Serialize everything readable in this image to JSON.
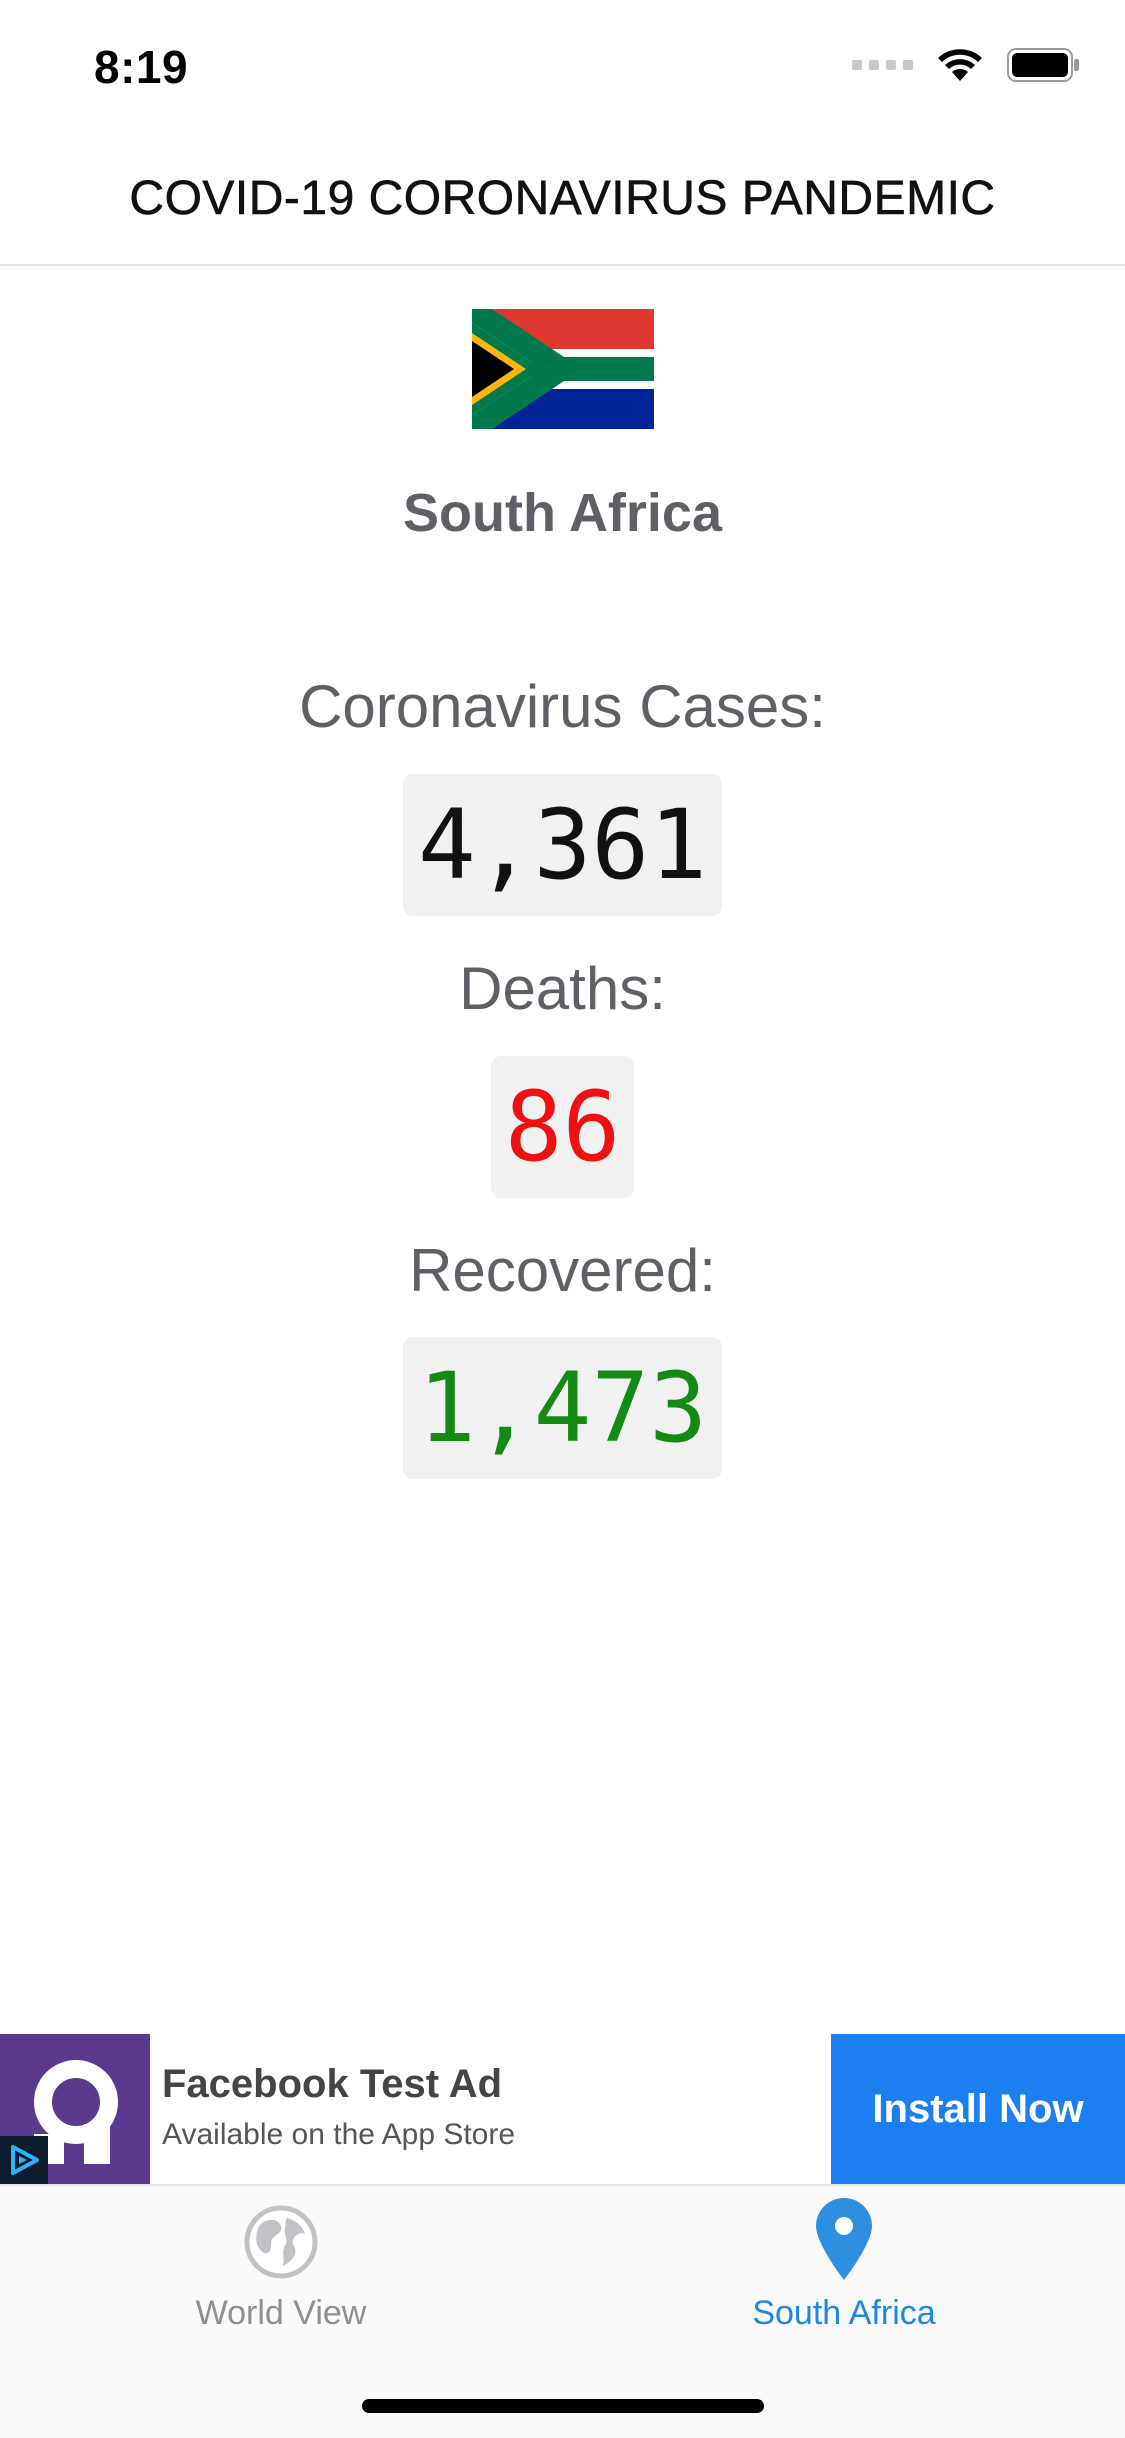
{
  "status_bar": {
    "time": "8:19"
  },
  "header": {
    "title": "COVID-19 CORONAVIRUS PANDEMIC"
  },
  "country": {
    "name": "South Africa",
    "flag_icon": "south-africa-flag-icon"
  },
  "stats": {
    "cases_label": "Coronavirus Cases:",
    "cases_value": "4,361",
    "deaths_label": "Deaths:",
    "deaths_value": "86",
    "recovered_label": "Recovered:",
    "recovered_value": "1,473"
  },
  "ad": {
    "title": "Facebook Test Ad",
    "subtitle": "Available on the App Store",
    "install_label": "Install Now"
  },
  "tabs": [
    {
      "label": "World View",
      "icon": "globe-icon",
      "active": false
    },
    {
      "label": "South Africa",
      "icon": "location-pin-icon",
      "active": true
    }
  ],
  "colors": {
    "deaths": "#ee1111",
    "recovered": "#138a13",
    "accent": "#1d86e8",
    "ad_button": "#1b7ff2",
    "ad_logo_bg": "#5a3a8e"
  }
}
